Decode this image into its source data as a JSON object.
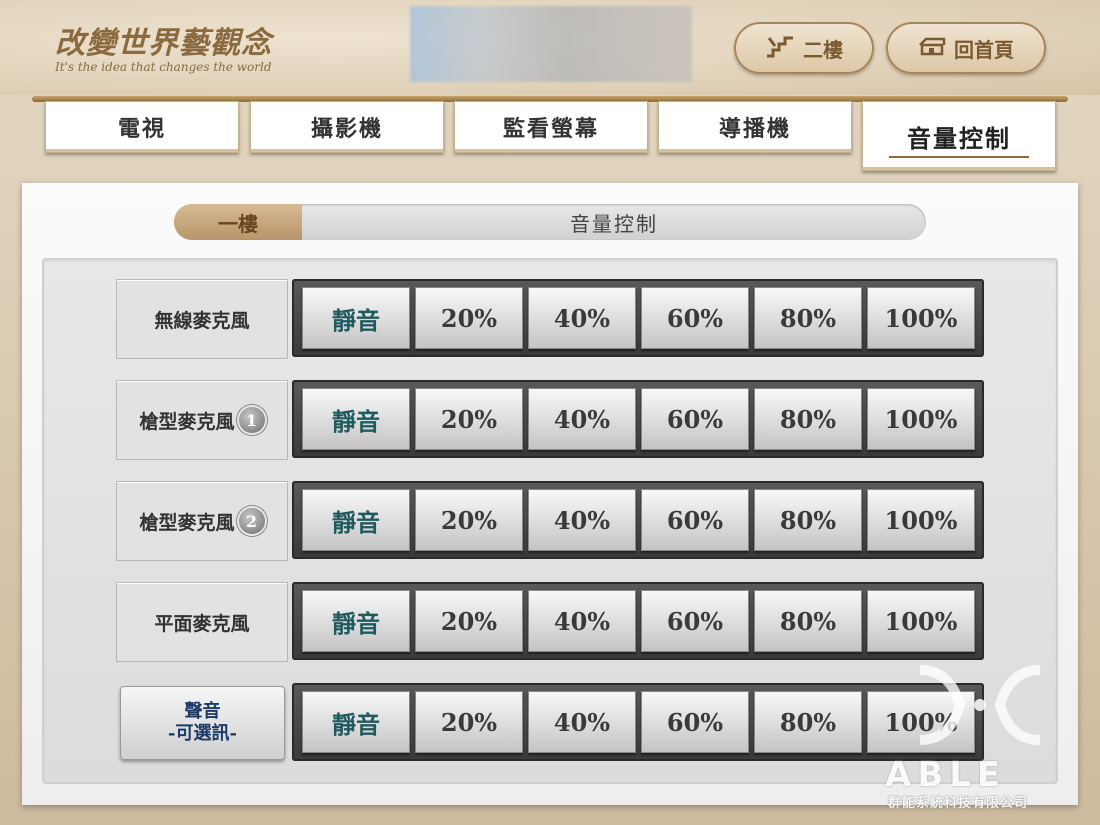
{
  "logo": {
    "title": "改變世界藝觀念",
    "subtitle": "It's the idea that changes the world"
  },
  "header": {
    "floor_button": "二樓",
    "home_button": "回首頁"
  },
  "tabs": [
    {
      "label": "電視"
    },
    {
      "label": "攝影機"
    },
    {
      "label": "監看螢幕"
    },
    {
      "label": "導播機"
    },
    {
      "label": "音量控制"
    }
  ],
  "active_tab_index": 4,
  "floor": {
    "tag": "一樓",
    "title": "音量控制"
  },
  "rows": [
    {
      "label": "無線麥克風",
      "badge": ""
    },
    {
      "label": "槍型麥克風",
      "badge": "1"
    },
    {
      "label": "槍型麥克風",
      "badge": "2"
    },
    {
      "label": "平面麥克風",
      "badge": ""
    },
    {
      "label": "聲音",
      "sublabel": "-可選訊-",
      "is_button": true
    }
  ],
  "volume_buttons": [
    "靜音",
    "20%",
    "40%",
    "60%",
    "80%",
    "100%"
  ],
  "watermark": {
    "brand": "ABLE",
    "company": "群能系統科技有限公司"
  },
  "colors": {
    "accent_gold": "#8a6a3e",
    "mute_text": "#1f5a5f",
    "select_text": "#1c3a6a"
  }
}
